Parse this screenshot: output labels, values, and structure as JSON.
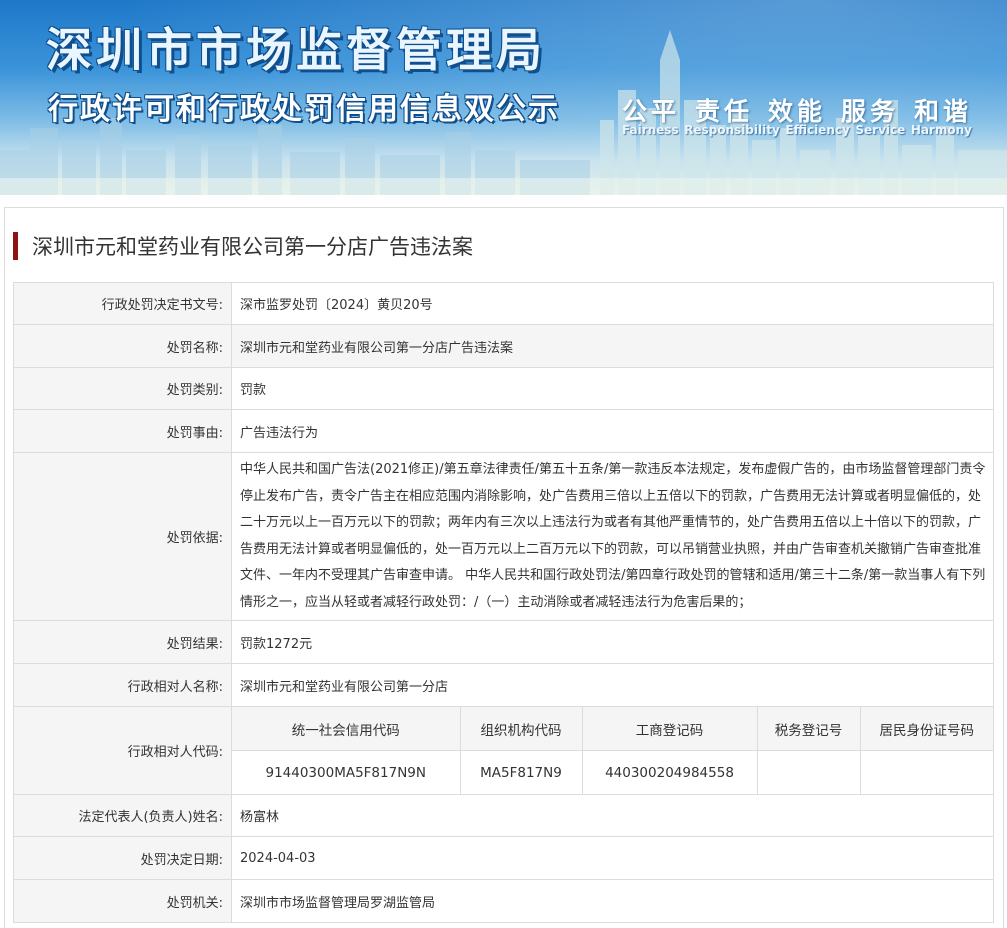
{
  "banner": {
    "title": "深圳市市场监督管理局",
    "subtitle": "行政许可和行政处罚信用信息双公示",
    "slogans": [
      {
        "zh": "公平",
        "en": "Fairness"
      },
      {
        "zh": "责任",
        "en": "Responsibility"
      },
      {
        "zh": "效能",
        "en": "Efficiency"
      },
      {
        "zh": "服务",
        "en": "Service"
      },
      {
        "zh": "和谐",
        "en": "Harmony"
      }
    ]
  },
  "case_title": "深圳市元和堂药业有限公司第一分店广告违法案",
  "fields": {
    "doc_no": {
      "label": "行政处罚决定书文号:",
      "value": "深市监罗处罚〔2024〕黄贝20号"
    },
    "penalty_name": {
      "label": "处罚名称:",
      "value": "深圳市元和堂药业有限公司第一分店广告违法案"
    },
    "penalty_type": {
      "label": "处罚类别:",
      "value": "罚款"
    },
    "penalty_reason": {
      "label": "处罚事由:",
      "value": "广告违法行为"
    },
    "penalty_basis": {
      "label": "处罚依据:",
      "value": "中华人民共和国广告法(2021修正)/第五章法律责任/第五十五条/第一款违反本法规定，发布虚假广告的，由市场监督管理部门责令停止发布广告，责令广告主在相应范围内消除影响，处广告费用三倍以上五倍以下的罚款，广告费用无法计算或者明显偏低的，处二十万元以上一百万元以下的罚款；两年内有三次以上违法行为或者有其他严重情节的，处广告费用五倍以上十倍以下的罚款，广告费用无法计算或者明显偏低的，处一百万元以上二百万元以下的罚款，可以吊销营业执照，并由广告审查机关撤销广告审查批准文件、一年内不受理其广告审查申请。 中华人民共和国行政处罚法/第四章行政处罚的管辖和适用/第三十二条/第一款当事人有下列情形之一，应当从轻或者减轻行政处罚：/（一）主动消除或者减轻违法行为危害后果的；"
    },
    "penalty_result": {
      "label": "处罚结果:",
      "value": "罚款1272元"
    },
    "party_name": {
      "label": "行政相对人名称:",
      "value": "深圳市元和堂药业有限公司第一分店"
    },
    "party_codes": {
      "label": "行政相对人代码:",
      "headers": [
        "统一社会信用代码",
        "组织机构代码",
        "工商登记码",
        "税务登记号",
        "居民身份证号码"
      ],
      "values": [
        "91440300MA5F817N9N",
        "MA5F817N9",
        "440300204984558",
        "",
        ""
      ]
    },
    "legal_rep": {
      "label": "法定代表人(负责人)姓名:",
      "value": "杨富林"
    },
    "decision_date": {
      "label": "处罚决定日期:",
      "value": "2024-04-03"
    },
    "authority": {
      "label": "处罚机关:",
      "value": "深圳市市场监督管理局罗湖监管局"
    }
  },
  "colors": {
    "accent_bar": "#8e1313",
    "banner_blue": "#1f78c8",
    "label_bg": "#f5f5f5",
    "border": "#dcdcdc"
  }
}
